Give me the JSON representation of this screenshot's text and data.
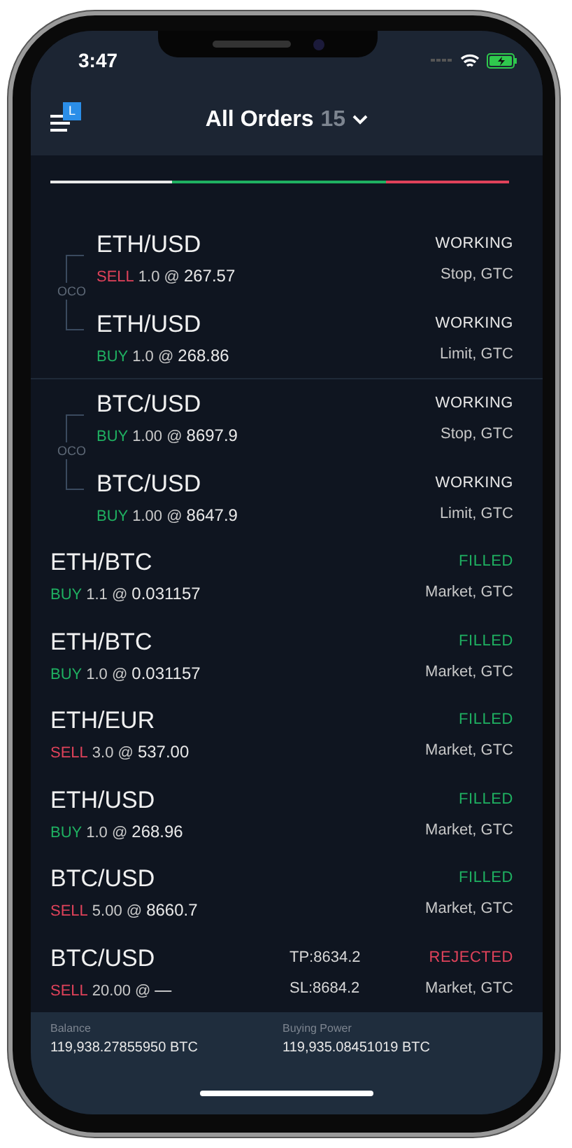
{
  "status_bar": {
    "time": "3:47"
  },
  "header": {
    "badge": "L",
    "title": "All Orders",
    "count": "15"
  },
  "summary_bar": [
    {
      "color": "#e8e8e8"
    },
    {
      "color": "#1fb061"
    },
    {
      "color": "#e0425a"
    }
  ],
  "orders": [
    {
      "kind": "oco",
      "label": "OCO",
      "orders": [
        {
          "pair": "ETH/USD",
          "side": {
            "label": "SELL",
            "color": "#e0425a"
          },
          "quantity": "1.0 @",
          "price": "267.57",
          "status": {
            "label": "WORKING",
            "color": "#e8e8e8"
          },
          "type": "Stop, GTC"
        },
        {
          "pair": "ETH/USD",
          "side": {
            "label": "BUY",
            "color": "#1fb061"
          },
          "quantity": "1.0 @",
          "price": "268.86",
          "status": {
            "label": "WORKING",
            "color": "#e8e8e8"
          },
          "type": "Limit, GTC"
        }
      ]
    },
    {
      "kind": "oco",
      "label": "OCO",
      "orders": [
        {
          "pair": "BTC/USD",
          "side": {
            "label": "BUY",
            "color": "#1fb061"
          },
          "quantity": "1.00 @",
          "price": "8697.9",
          "status": {
            "label": "WORKING",
            "color": "#e8e8e8"
          },
          "type": "Stop, GTC"
        },
        {
          "pair": "BTC/USD",
          "side": {
            "label": "BUY",
            "color": "#1fb061"
          },
          "quantity": "1.00 @",
          "price": "8647.9",
          "status": {
            "label": "WORKING",
            "color": "#e8e8e8"
          },
          "type": "Limit, GTC"
        }
      ]
    },
    {
      "kind": "single",
      "pair": "ETH/BTC",
      "side": {
        "label": "BUY",
        "color": "#1fb061"
      },
      "quantity": "1.1 @",
      "price": "0.031157",
      "status": {
        "label": "FILLED",
        "color": "#1fb061"
      },
      "type": "Market, GTC"
    },
    {
      "kind": "single",
      "pair": "ETH/BTC",
      "side": {
        "label": "BUY",
        "color": "#1fb061"
      },
      "quantity": "1.0 @",
      "price": "0.031157",
      "status": {
        "label": "FILLED",
        "color": "#1fb061"
      },
      "type": "Market, GTC"
    },
    {
      "kind": "single",
      "pair": "ETH/EUR",
      "side": {
        "label": "SELL",
        "color": "#e0425a"
      },
      "quantity": "3.0 @",
      "price": "537.00",
      "status": {
        "label": "FILLED",
        "color": "#1fb061"
      },
      "type": "Market, GTC"
    },
    {
      "kind": "single",
      "pair": "ETH/USD",
      "side": {
        "label": "BUY",
        "color": "#1fb061"
      },
      "quantity": "1.0 @",
      "price": "268.96",
      "status": {
        "label": "FILLED",
        "color": "#1fb061"
      },
      "type": "Market, GTC"
    },
    {
      "kind": "single",
      "pair": "BTC/USD",
      "side": {
        "label": "SELL",
        "color": "#e0425a"
      },
      "quantity": "5.00 @",
      "price": "8660.7",
      "status": {
        "label": "FILLED",
        "color": "#1fb061"
      },
      "type": "Market, GTC"
    },
    {
      "kind": "single",
      "pair": "BTC/USD",
      "side": {
        "label": "SELL",
        "color": "#e0425a"
      },
      "quantity": "20.00 @",
      "price": "—",
      "take_profit": "TP:8634.2",
      "stop_loss": "SL:8684.2",
      "status": {
        "label": "REJECTED",
        "color": "#e0425a"
      },
      "type": "Market, GTC"
    }
  ],
  "footer": [
    {
      "label": "Balance",
      "value": "119,938.27855950 BTC"
    },
    {
      "label": "Buying Power",
      "value": "119,935.08451019 BTC"
    }
  ]
}
